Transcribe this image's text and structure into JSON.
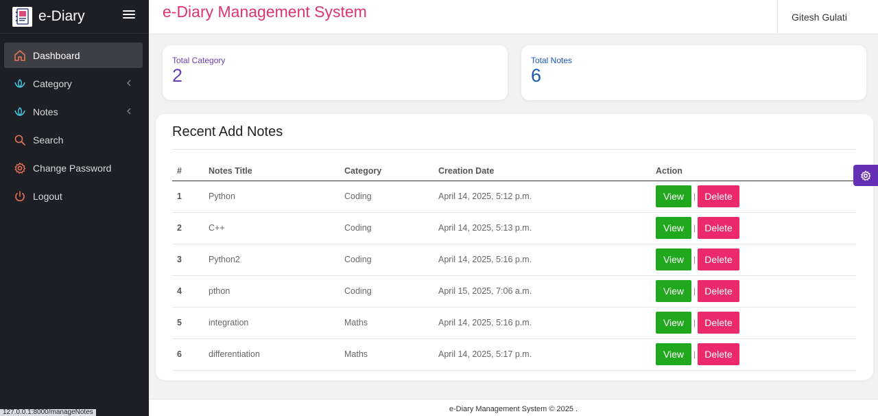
{
  "brand": {
    "name": "e-Diary",
    "logo_icon": "diary-logo-icon"
  },
  "sidebar": {
    "items": [
      {
        "label": "Dashboard",
        "icon": "home-icon",
        "active": true
      },
      {
        "label": "Category",
        "icon": "lotus-icon",
        "has_submenu": true
      },
      {
        "label": "Notes",
        "icon": "lotus-icon",
        "has_submenu": true
      },
      {
        "label": "Search",
        "icon": "search-icon"
      },
      {
        "label": "Change Password",
        "icon": "gear-icon"
      },
      {
        "label": "Logout",
        "icon": "power-icon"
      }
    ]
  },
  "header": {
    "title": "e-Diary Management System",
    "user": "Gitesh Gulati"
  },
  "stats": {
    "category": {
      "label": "Total Category",
      "value": "2"
    },
    "notes": {
      "label": "Total Notes",
      "value": "6"
    }
  },
  "recent": {
    "title": "Recent Add Notes",
    "columns": [
      "#",
      "Notes Title",
      "Category",
      "Creation Date",
      "Action"
    ],
    "view_label": "View",
    "delete_label": "Delete",
    "separator": "|",
    "rows": [
      {
        "num": "1",
        "title": "Python",
        "category": "Coding",
        "date": "April 14, 2025, 5:12 p.m."
      },
      {
        "num": "2",
        "title": "C++",
        "category": "Coding",
        "date": "April 14, 2025, 5:13 p.m."
      },
      {
        "num": "3",
        "title": "Python2",
        "category": "Coding",
        "date": "April 14, 2025, 5:16 p.m."
      },
      {
        "num": "4",
        "title": "pthon",
        "category": "Coding",
        "date": "April 15, 2025, 7:06 a.m."
      },
      {
        "num": "5",
        "title": "integration",
        "category": "Maths",
        "date": "April 14, 2025, 5:16 p.m."
      },
      {
        "num": "6",
        "title": "differentiation",
        "category": "Maths",
        "date": "April 14, 2025, 5:17 p.m."
      }
    ]
  },
  "footer": {
    "text": "e-Diary Management System © 2025 ."
  },
  "status_url": "127.0.0.1:8000/manageNotes",
  "colors": {
    "accent_title": "#e0356b",
    "category_stat": "#6a3fb3",
    "notes_stat": "#1a58b8",
    "view_button": "#22a81e",
    "delete_button": "#ea2a6c",
    "settings_fab": "#6431b5",
    "sidebar_bg": "#1e1f24"
  }
}
